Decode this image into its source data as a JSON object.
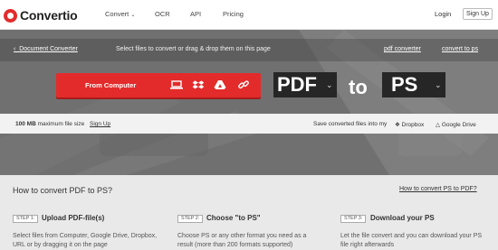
{
  "nav": {
    "brand": "Convertio",
    "links": [
      "Convert",
      "OCR",
      "API",
      "Pricing"
    ],
    "login": "Login",
    "signup": "Sign Up"
  },
  "strip": {
    "back": "Document Converter",
    "instruction": "Select files to convert or drag & drop them on this page",
    "link_pdf": "pdf converter",
    "link_ps": "convert to ps"
  },
  "upload": {
    "label": "From Computer",
    "icons": [
      "computer-icon",
      "dropbox-icon",
      "google-drive-icon",
      "link-icon"
    ]
  },
  "format": {
    "from": "PDF",
    "to_word": "to",
    "to": "PS"
  },
  "infobar": {
    "size_bold": "100 MB",
    "size_rest": "maximum file size",
    "signup": "Sign Up",
    "save_text": "Save converted files into my",
    "dropbox": "Dropbox",
    "gdrive": "Google Drive"
  },
  "howto": {
    "title": "How to convert PDF to PS?",
    "link": "How to convert PS to PDF?",
    "steps": [
      {
        "tag": "STEP 1:",
        "title": "Upload PDF-file(s)",
        "desc": "Select files from Computer, Google Drive, Dropbox, URL or by dragging it on the page"
      },
      {
        "tag": "STEP 2:",
        "title": "Choose \"to PS\"",
        "desc": "Choose PS or any other format you need as a result (more than 200 formats supported)"
      },
      {
        "tag": "STEP 3:",
        "title": "Download your PS",
        "desc": "Let the file convert and you can download your PS file right afterwards"
      }
    ]
  },
  "colors": {
    "accent": "#e32b2b",
    "hero": "#6e6e6e",
    "format_box": "#262626"
  }
}
